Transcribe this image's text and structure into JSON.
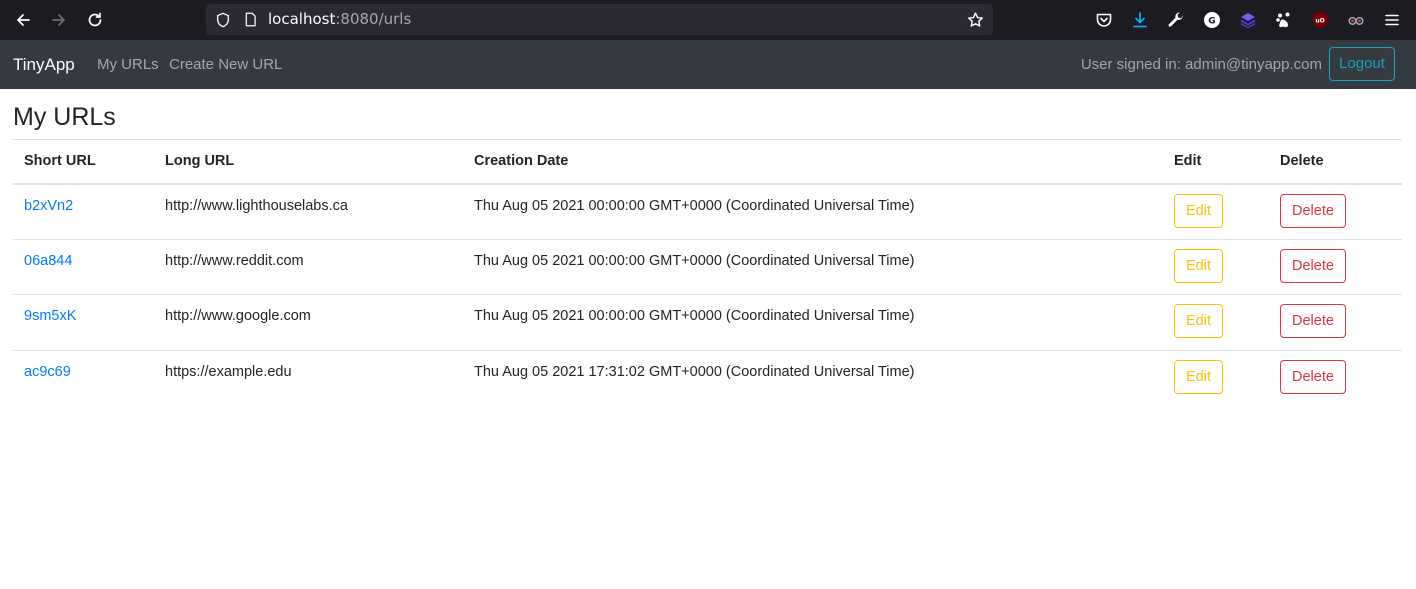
{
  "browser": {
    "url_host": "localhost",
    "url_rest": ":8080/urls"
  },
  "navbar": {
    "brand": "TinyApp",
    "links": [
      "My URLs",
      "Create New URL"
    ],
    "signed_in_text": "User signed in: admin@tinyapp.com",
    "logout_label": "Logout"
  },
  "page": {
    "title": "My URLs"
  },
  "table": {
    "headers": [
      "Short URL",
      "Long URL",
      "Creation Date",
      "Edit",
      "Delete"
    ],
    "rows": [
      {
        "short": "b2xVn2",
        "long": "http://www.lighthouselabs.ca",
        "date": "Thu Aug 05 2021 00:00:00 GMT+0000 (Coordinated Universal Time)",
        "edit": "Edit",
        "delete": "Delete"
      },
      {
        "short": "06a844",
        "long": "http://www.reddit.com",
        "date": "Thu Aug 05 2021 00:00:00 GMT+0000 (Coordinated Universal Time)",
        "edit": "Edit",
        "delete": "Delete"
      },
      {
        "short": "9sm5xK",
        "long": "http://www.google.com",
        "date": "Thu Aug 05 2021 00:00:00 GMT+0000 (Coordinated Universal Time)",
        "edit": "Edit",
        "delete": "Delete"
      },
      {
        "short": "ac9c69",
        "long": "https://example.edu",
        "date": "Thu Aug 05 2021 17:31:02 GMT+0000 (Coordinated Universal Time)",
        "edit": "Edit",
        "delete": "Delete"
      }
    ]
  },
  "colors": {
    "navbar_bg": "#343a40",
    "link": "#007bff",
    "edit": "#ffc107",
    "delete": "#dc3545",
    "logout": "#17a2b8"
  }
}
